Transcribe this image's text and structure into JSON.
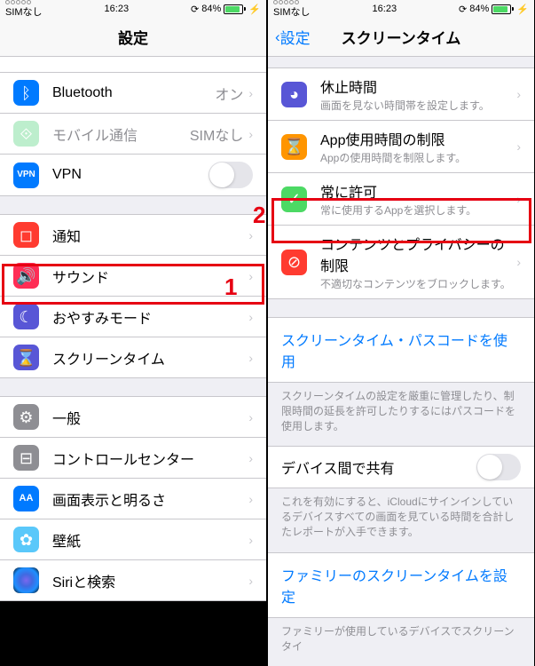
{
  "status": {
    "carrier": "SIMなし",
    "time": "16:23",
    "batt_pct": "84%"
  },
  "left": {
    "title": "設定",
    "cells": {
      "bluetooth": {
        "label": "Bluetooth",
        "value": "オン"
      },
      "cellular": {
        "label": "モバイル通信",
        "value": "SIMなし"
      },
      "vpn": {
        "label": "VPN"
      },
      "notifications": {
        "label": "通知"
      },
      "sound": {
        "label": "サウンド"
      },
      "dnd": {
        "label": "おやすみモード"
      },
      "screentime": {
        "label": "スクリーンタイム"
      },
      "general": {
        "label": "一般"
      },
      "control": {
        "label": "コントロールセンター"
      },
      "display": {
        "label": "画面表示と明るさ"
      },
      "wallpaper": {
        "label": "壁紙"
      },
      "siri": {
        "label": "Siriと検索"
      }
    }
  },
  "right": {
    "back": "設定",
    "title": "スクリーンタイム",
    "cells": {
      "downtime": {
        "label": "休止時間",
        "sub": "画面を見ない時間帯を設定します。"
      },
      "applimits": {
        "label": "App使用時間の制限",
        "sub": "Appの使用時間を制限します。"
      },
      "allowed": {
        "label": "常に許可",
        "sub": "常に使用するAppを選択します。"
      },
      "content": {
        "label": "コンテンツとプライバシーの制限",
        "sub": "不適切なコンテンツをブロックします。"
      }
    },
    "passcode_link": "スクリーンタイム・パスコードを使用",
    "passcode_footer": "スクリーンタイムの設定を厳重に管理したり、制限時間の延長を許可したりするにはパスコードを使用します。",
    "share": {
      "label": "デバイス間で共有"
    },
    "share_footer": "これを有効にすると、iCloudにサインインしているデバイスすべての画面を見ている時間を合計したレポートが入手できます。",
    "family_link": "ファミリーのスクリーンタイムを設定",
    "family_footer": "ファミリーが使用しているデバイスでスクリーンタイ"
  },
  "badges": {
    "one": "1",
    "two": "2"
  }
}
